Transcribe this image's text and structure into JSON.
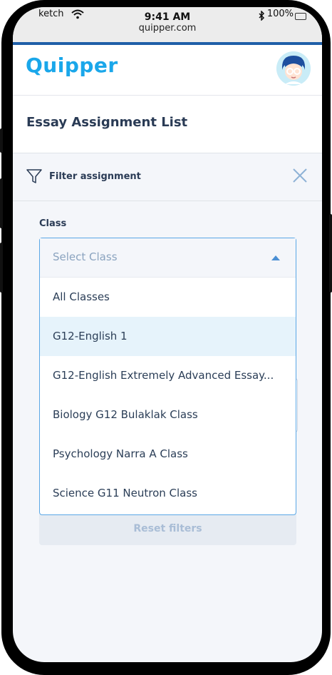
{
  "status_bar": {
    "carrier": "ketch",
    "time": "9:41 AM",
    "url": "quipper.com",
    "battery": "100%"
  },
  "header": {
    "logo_text": "Quipper",
    "brand_color": "#1aa7ea"
  },
  "page": {
    "title": "Essay Assignment List"
  },
  "filter": {
    "label": "Filter assignment",
    "class_label": "Class",
    "placeholder": "Select Class",
    "options": [
      "All Classes",
      "G12-English 1",
      "G12-English Extremely Advanced Essay...",
      "Biology G12 Bulaklak Class",
      "Psychology Narra A Class",
      "Science G11 Neutron Class"
    ],
    "highlighted_option": "G12-English 1",
    "reset_label": "Reset filters"
  },
  "icons": {
    "filter": "filter-icon",
    "close": "close-icon",
    "wifi": "wifi-icon",
    "bluetooth": "bluetooth-icon",
    "avatar": "avatar"
  }
}
